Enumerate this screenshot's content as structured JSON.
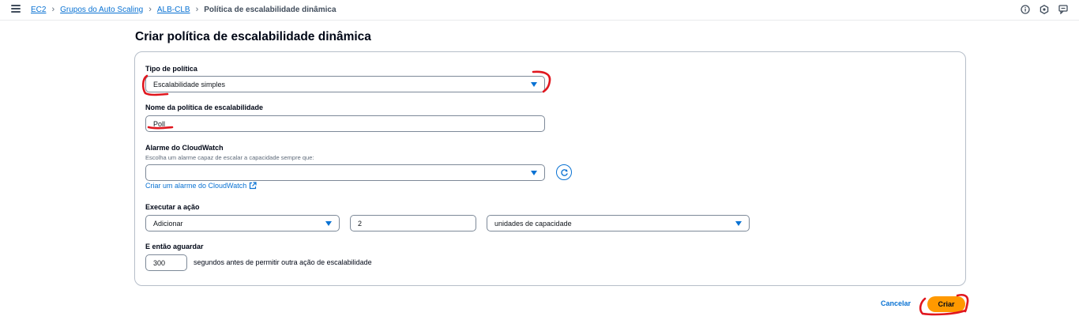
{
  "breadcrumb": {
    "items": [
      "EC2",
      "Grupos do Auto Scaling",
      "ALB-CLB"
    ],
    "current": "Política de escalabilidade dinâmica"
  },
  "top_icons": [
    "info-icon",
    "notifications-icon",
    "feedback-icon"
  ],
  "page": {
    "title": "Criar política de escalabilidade dinâmica"
  },
  "form": {
    "policy_type": {
      "label": "Tipo de política",
      "value": "Escalabilidade simples"
    },
    "policy_name": {
      "label": "Nome da política de escalabilidade",
      "value": "Poll"
    },
    "alarm": {
      "label": "Alarme do CloudWatch",
      "description": "Escolha um alarme capaz de escalar a capacidade sempre que:",
      "value": "",
      "create_link": "Criar um alarme do CloudWatch"
    },
    "action": {
      "label": "Executar a ação",
      "operation": "Adicionar",
      "amount": "2",
      "unit": "unidades de capacidade"
    },
    "wait": {
      "label": "E então aguardar",
      "value": "300",
      "suffix": "segundos antes de permitir outra ação de escalabilidade"
    }
  },
  "footer": {
    "cancel_label": "Cancelar",
    "create_label": "Criar"
  },
  "colors": {
    "accent": "#0972d3",
    "primary_button": "#ff9900",
    "annotation": "#e0161e"
  }
}
